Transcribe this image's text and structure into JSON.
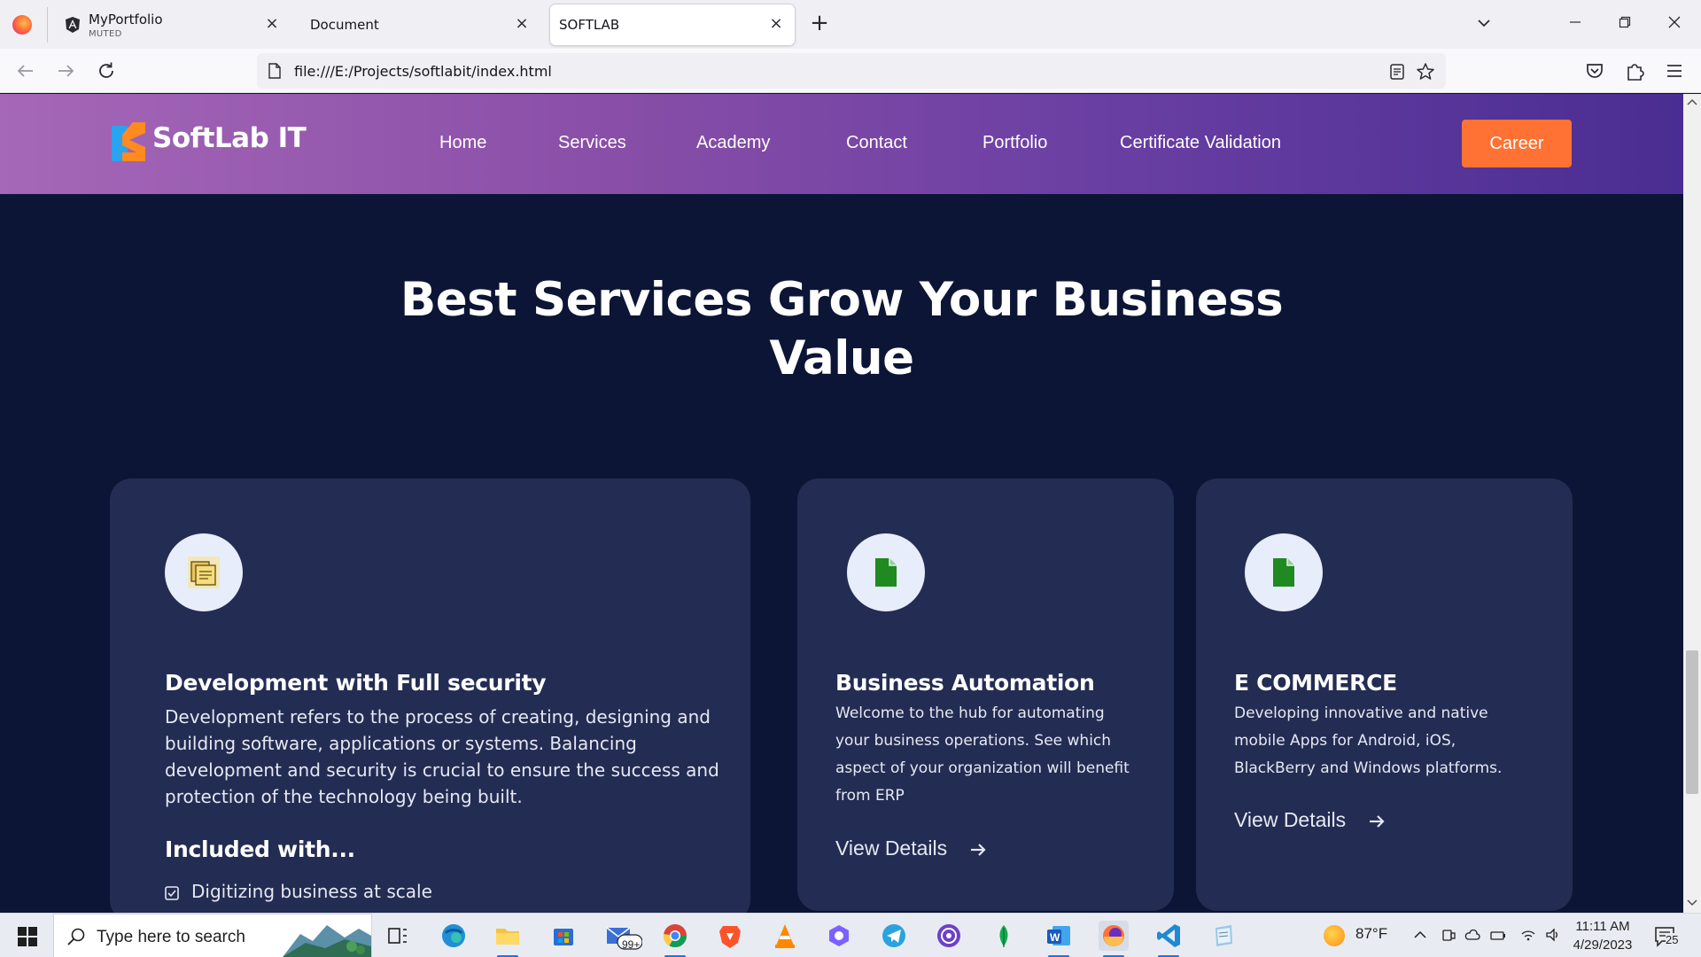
{
  "browser": {
    "tabs": [
      {
        "title": "MyPortfolio",
        "subtitle": "MUTED"
      },
      {
        "title": "Document"
      },
      {
        "title": "SOFTLAB"
      }
    ],
    "url": "file:///E:/Projects/softlabit/index.html"
  },
  "site": {
    "logo": "SoftLab IT",
    "menu": [
      "Home",
      "Services",
      "Academy",
      "Contact",
      "Portfolio",
      "Certificate Validation"
    ],
    "cta": "Career",
    "hero_title": "Best Services Grow Your Business Value",
    "cards": [
      {
        "icon": "folder-documents-icon",
        "title": "Development with Full security",
        "desc": "Development refers to the process of creating, designing and building software, applications or systems. Balancing development and security is crucial to ensure the success and protection of the technology being built.",
        "included_title": "Included with...",
        "included": [
          "Digitizing business at scale"
        ]
      },
      {
        "icon": "document-icon",
        "title": "Business Automation",
        "desc": "Welcome to the hub for automating your business operations. See which aspect of your organization will benefit from ERP",
        "link": "View Details"
      },
      {
        "icon": "document-icon",
        "title": "E COMMERCE",
        "desc": "Developing innovative and native mobile Apps for Android, iOS, BlackBerry and Windows platforms.",
        "link": "View Details"
      }
    ]
  },
  "taskbar": {
    "search_placeholder": "Type here to search",
    "mail_badge": "99+",
    "weather": "87°F",
    "time": "11:11 AM",
    "date": "4/29/2023",
    "notifications": "25"
  },
  "colors": {
    "page_bg": "#0c1535",
    "card_bg": "#232c52",
    "cta": "#ff7233",
    "header_gradient": [
      "#a567b7",
      "#4a2d92"
    ]
  }
}
